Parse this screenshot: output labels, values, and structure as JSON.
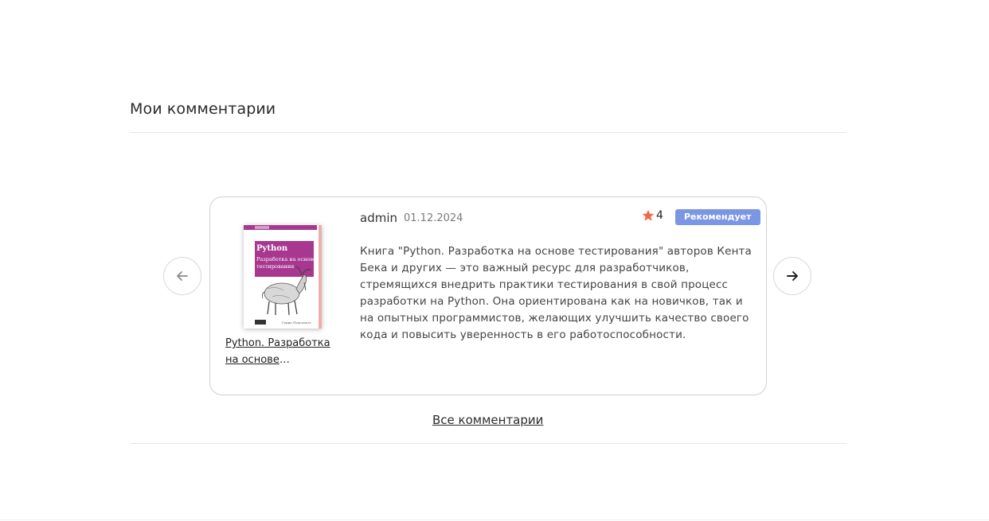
{
  "section": {
    "title": "Мои комментарии"
  },
  "review": {
    "book_title": "Python. Разработка на основе тестировани...",
    "author": "admin",
    "date": "01.12.2024",
    "rating": "4",
    "badge": "Рекомендует",
    "text": "Книга \"Python. Разработка на основе тестирования\" авторов Кента Бека и других — это важный ресурс для разработчиков, стремящихся внедрить практики тестирования в свой процесс разработки на Python. Она ориентирована как на новичков, так и на опытных программистов, желающих улучшить качество своего кода и повысить уверенность в его работоспособности."
  },
  "cover": {
    "title": "Python",
    "subtitle_line1": "Разработка на основе",
    "subtitle_line2": "тестирования",
    "author": "Гарри Персиваль"
  },
  "footer": {
    "all_comments_label": "Все комментарии"
  },
  "colors": {
    "badge": "#7b96e5",
    "star": "#ee6a47",
    "cover_magenta": "#a8378f"
  },
  "icons": {
    "prev": "arrow-left-icon",
    "next": "arrow-right-icon",
    "rating": "star-icon"
  }
}
